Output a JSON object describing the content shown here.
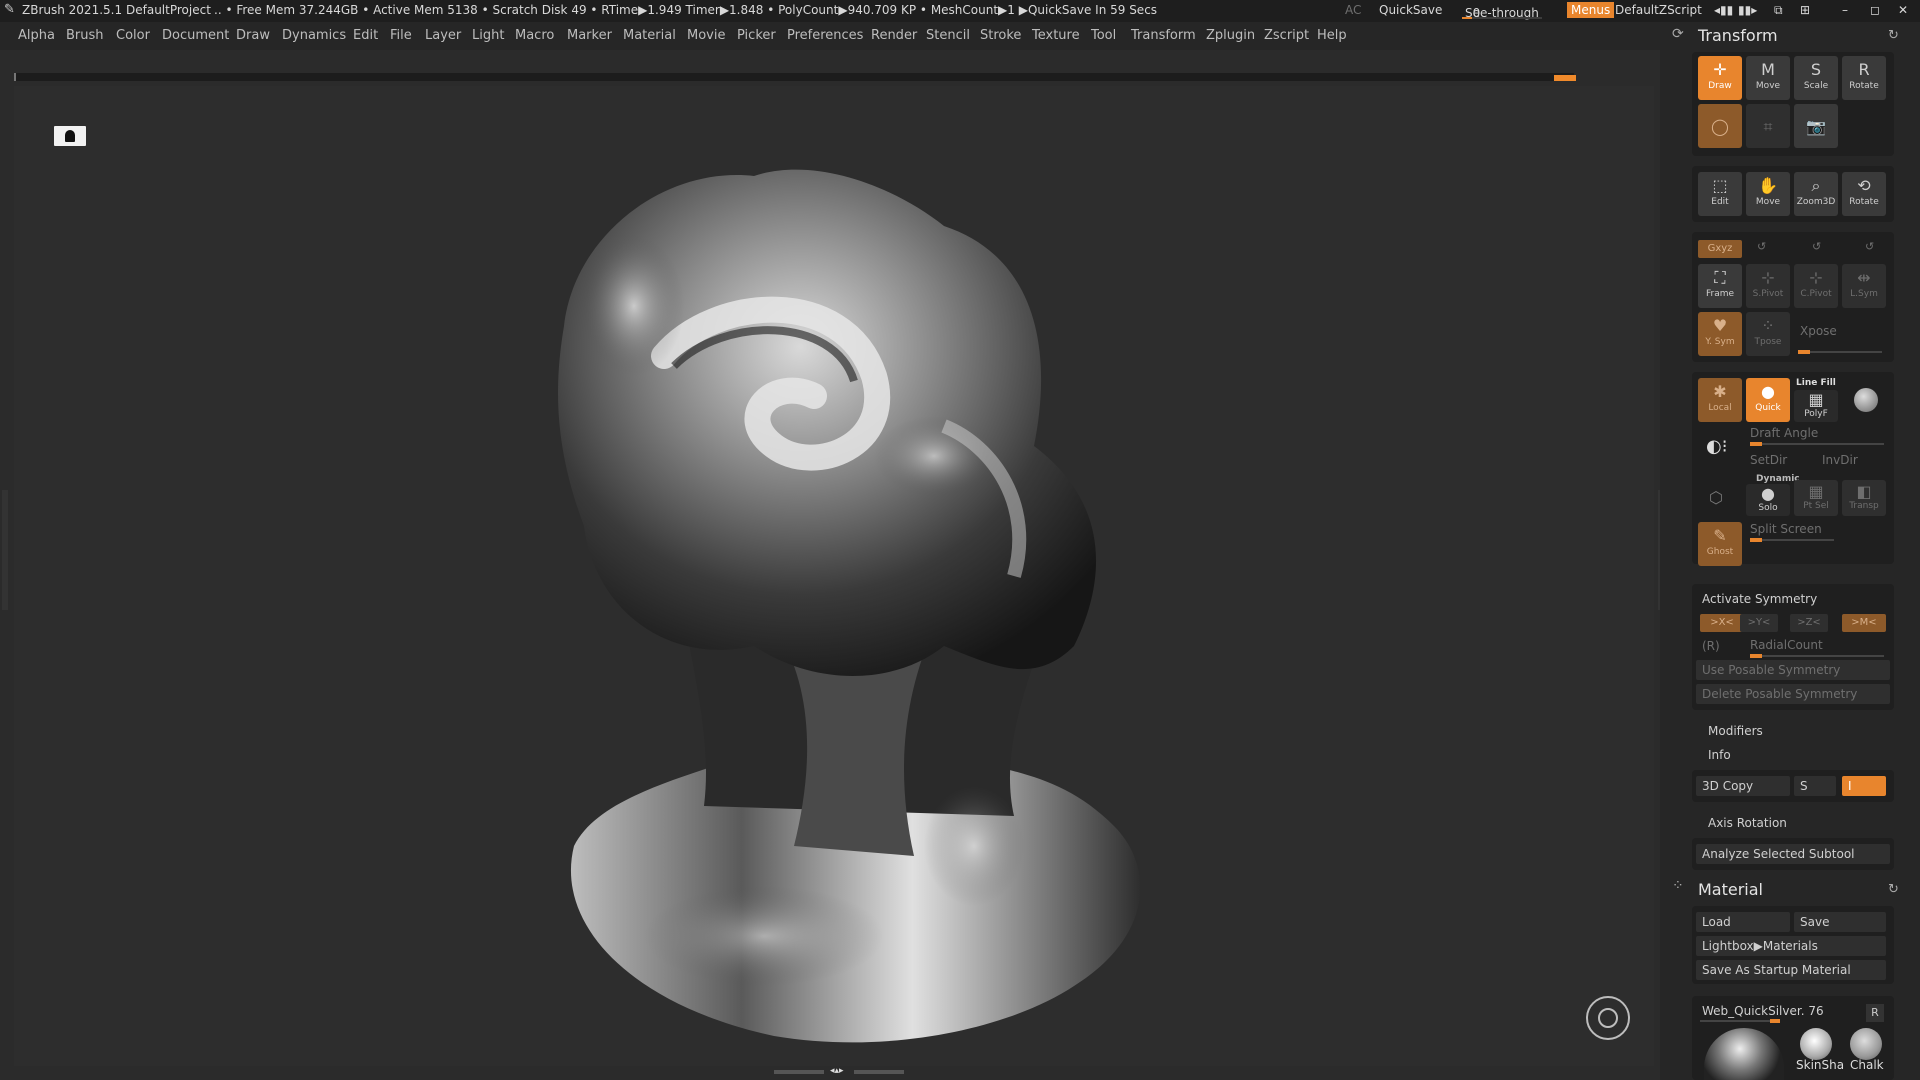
{
  "titlebar": {
    "app": "ZBrush 2021.5.1",
    "project": "DefaultProject",
    "stats": ".. • Free Mem 37.244GB • Active Mem 5138 • Scratch Disk 49 • RTime▶1.949 Timer▶1.848 • PolyCount▶940.709 KP • MeshCount▶1 ▶QuickSave In 59 Secs",
    "ac": "AC",
    "quicksave": "QuickSave",
    "seethrough": "See-through",
    "seethrough_value": "0",
    "menus": "Menus",
    "script": "DefaultZScript"
  },
  "menu": [
    "Alpha",
    "Brush",
    "Color",
    "Document",
    "Draw",
    "Dynamics",
    "Edit",
    "File",
    "Layer",
    "Light",
    "Macro",
    "Marker",
    "Material",
    "Movie",
    "Picker",
    "Preferences",
    "Render",
    "Stencil",
    "Stroke",
    "Texture",
    "Tool",
    "Transform",
    "Zplugin",
    "Zscript",
    "Help"
  ],
  "transform": {
    "title": "Transform",
    "draw": "Draw",
    "move": "Move",
    "scale": "Scale",
    "rotate": "Rotate",
    "edit": "Edit",
    "move2": "Move",
    "zoom3d": "Zoom3D",
    "rotate2": "Rotate",
    "xyz": "Gxyz",
    "frame": "Frame",
    "spivot": "S.Pivot",
    "cpivot": "C.Pivot",
    "lsym": "L.Sym",
    "vsym": "Y. Sym",
    "tpose": "Tpose",
    "xpose": "Xpose",
    "local": "Local",
    "quick": "Quick",
    "linefill": "Line Fill",
    "polyf": "PolyF",
    "draft_angle": "Draft Angle",
    "setdir": "SetDir",
    "invdir": "InvDir",
    "dynamic": "Dynamic",
    "solo": "Solo",
    "ptsel": "Pt Sel",
    "transp": "Transp",
    "ghost": "Ghost",
    "split_screen": "Split Screen",
    "activate_symmetry": "Activate Symmetry",
    "sym_x": ">X<",
    "sym_y": ">Y<",
    "sym_z": ">Z<",
    "sym_m": ">M<",
    "r": "(R)",
    "radialcount": "RadialCount",
    "use_posable": "Use Posable Symmetry",
    "delete_posable": "Delete Posable Symmetry",
    "modifiers": "Modifiers",
    "info": "Info",
    "copy3d": "3D Copy",
    "s": "S",
    "i": "I",
    "axis_rotation": "Axis Rotation",
    "analyze": "Analyze Selected Subtool"
  },
  "material": {
    "title": "Material",
    "load": "Load",
    "save": "Save",
    "lightbox": "Lightbox▶Materials",
    "startup": "Save As Startup Material",
    "current": "Web_QuickSilver. 76",
    "r": "R",
    "thumb1": "SkinSha",
    "thumb2": "Chalk"
  },
  "colors": {
    "accent": "#e8852d",
    "background": "#2d2d2d",
    "panel": "#262626"
  }
}
